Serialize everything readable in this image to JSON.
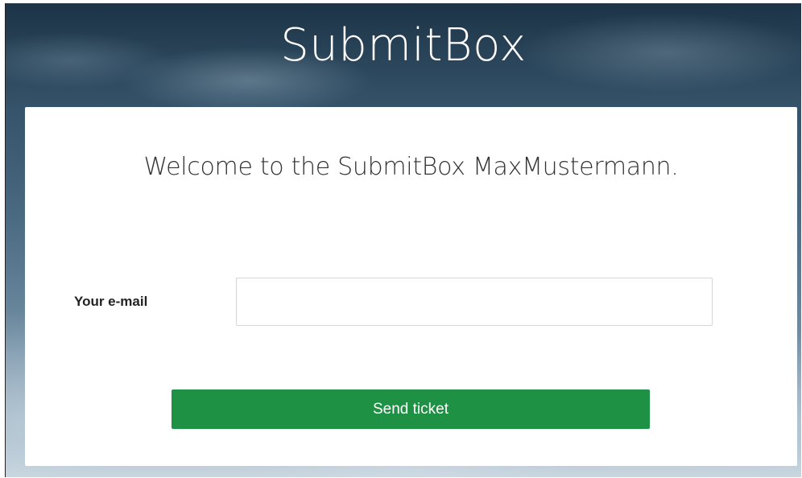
{
  "header": {
    "brand": "SubmitBox"
  },
  "card": {
    "welcome": "Welcome to the SubmitBox MaxMustermann.",
    "email": {
      "label": "Your e-mail",
      "value": "",
      "placeholder": ""
    },
    "submit_label": "Send ticket"
  },
  "colors": {
    "button": "#1e9145",
    "background_top": "#1d3447",
    "background_bottom": "#c9d6df"
  }
}
